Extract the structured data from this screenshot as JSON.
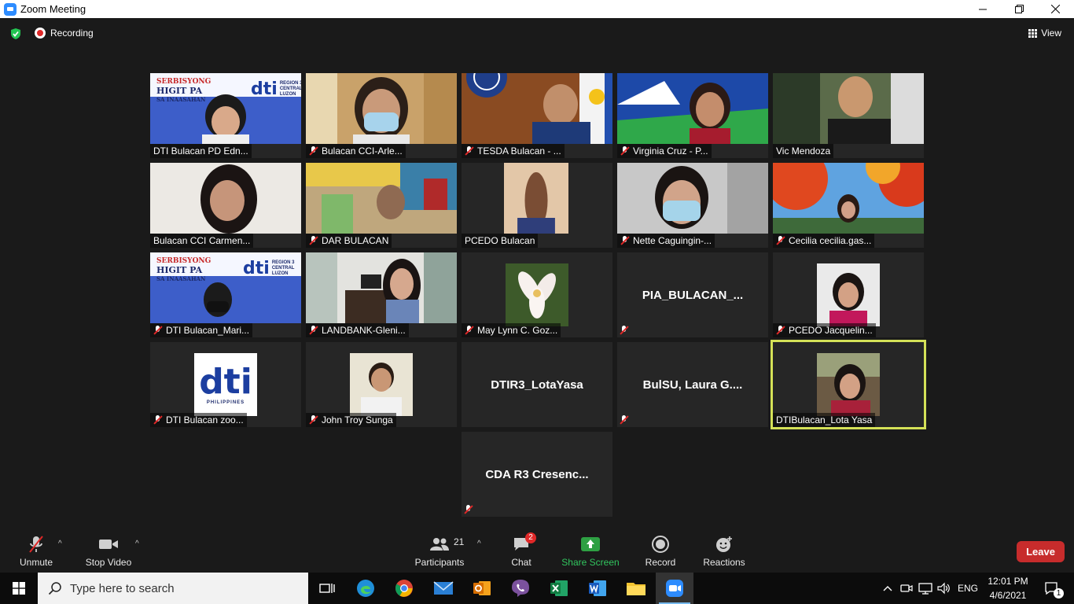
{
  "window": {
    "title": "Zoom Meeting"
  },
  "status": {
    "recording_label": "Recording",
    "view_label": "View"
  },
  "participants": [
    {
      "name": "DTI Bulacan PD Edn...",
      "muted": false
    },
    {
      "name": "Bulacan CCI-Arle...",
      "muted": true
    },
    {
      "name": "TESDA Bulacan - ...",
      "muted": true
    },
    {
      "name": "Virginia Cruz - P...",
      "muted": true
    },
    {
      "name": "Vic Mendoza",
      "muted": false
    },
    {
      "name": "Bulacan CCI Carmen...",
      "muted": false
    },
    {
      "name": "DAR BULACAN",
      "muted": true
    },
    {
      "name": "PCEDO Bulacan",
      "muted": false
    },
    {
      "name": "Nette Caguingin-...",
      "muted": true
    },
    {
      "name": "Cecilia cecilia.gas...",
      "muted": true
    },
    {
      "name": "DTI Bulacan_Mari...",
      "muted": true
    },
    {
      "name": "LANDBANK-Gleni...",
      "muted": true
    },
    {
      "name": "May Lynn C. Goz...",
      "muted": true
    },
    {
      "name": "PIA_BULACAN_...",
      "muted": true
    },
    {
      "name": "PCEDO Jacquelin...",
      "muted": true
    },
    {
      "name": "DTI Bulacan zoo...",
      "muted": true
    },
    {
      "name": "John Troy Sunga",
      "muted": true
    },
    {
      "name": "DTIR3_LotaYasa",
      "muted": false
    },
    {
      "name": "BulSU, Laura G....",
      "muted": true
    },
    {
      "name": "DTIBulacan_Lota Yasa",
      "muted": false
    },
    {
      "name": "CDA R3 Cresenc...",
      "muted": true
    }
  ],
  "logos": {
    "serbisyong_line1": "SERBISYONG",
    "serbisyong_line2": "HIGIT PA",
    "serbisyong_line3": "SA INAASAHAN",
    "dti": "dti",
    "region_line1": "REGION 3",
    "region_line2": "CENTRAL",
    "region_line3": "LUZON",
    "philippines": "PHILIPPINES"
  },
  "toolbar": {
    "unmute": "Unmute",
    "stop_video": "Stop Video",
    "participants": "Participants",
    "participants_count": "21",
    "chat": "Chat",
    "chat_badge": "2",
    "share_screen": "Share Screen",
    "record": "Record",
    "reactions": "Reactions",
    "leave": "Leave"
  },
  "taskbar": {
    "search_placeholder": "Type here to search",
    "lang": "ENG",
    "time": "12:01 PM",
    "date": "4/6/2021",
    "notification_count": "1"
  },
  "colors": {
    "accent": "#2d8cff",
    "leave": "#c72c2c",
    "share": "#2ea043",
    "active_speaker": "#d4e157"
  }
}
